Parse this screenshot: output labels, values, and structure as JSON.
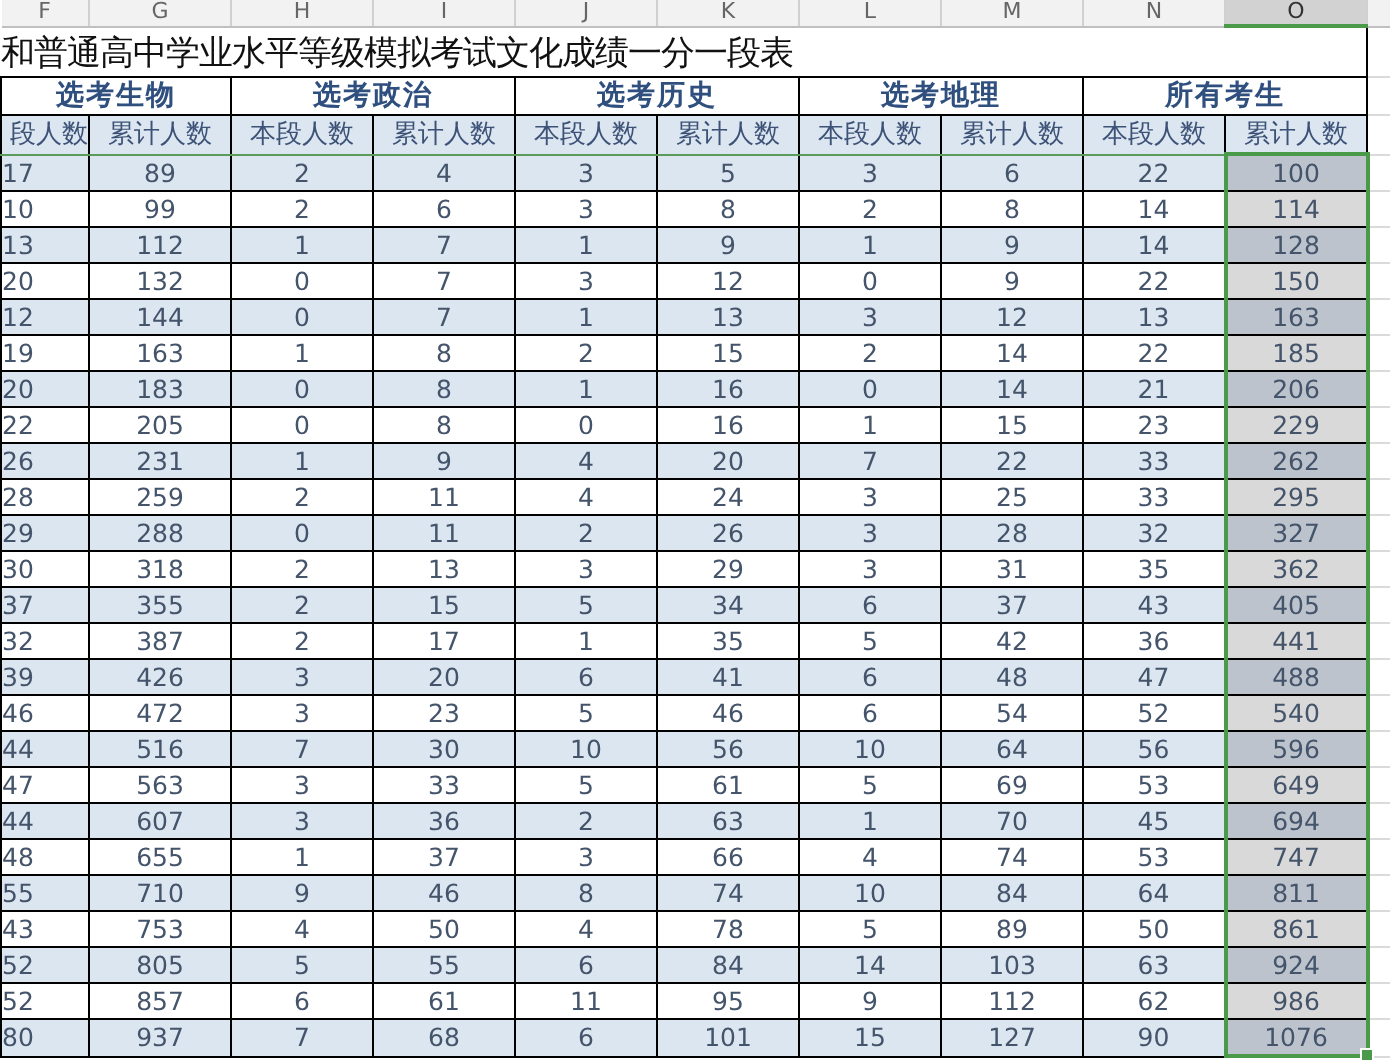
{
  "columns": [
    {
      "letter": "F",
      "selected": false
    },
    {
      "letter": "G",
      "selected": false
    },
    {
      "letter": "H",
      "selected": false
    },
    {
      "letter": "I",
      "selected": false
    },
    {
      "letter": "J",
      "selected": false
    },
    {
      "letter": "K",
      "selected": false
    },
    {
      "letter": "L",
      "selected": false
    },
    {
      "letter": "M",
      "selected": false
    },
    {
      "letter": "N",
      "selected": false
    },
    {
      "letter": "O",
      "selected": true
    }
  ],
  "title": "和普通高中学业水平等级模拟考试文化成绩一分一段表",
  "groups": [
    "选考生物",
    "选考政治",
    "选考历史",
    "选考地理",
    "所有考生"
  ],
  "subheaders": [
    "段人数",
    "累计人数",
    "本段人数",
    "累计人数",
    "本段人数",
    "累计人数",
    "本段人数",
    "累计人数",
    "本段人数",
    "累计人数"
  ],
  "rows": [
    {
      "cells": [
        "17",
        "89",
        "2",
        "4",
        "3",
        "5",
        "3",
        "6",
        "22",
        "100"
      ]
    },
    {
      "cells": [
        "10",
        "99",
        "2",
        "6",
        "3",
        "8",
        "2",
        "8",
        "14",
        "114"
      ]
    },
    {
      "cells": [
        "13",
        "112",
        "1",
        "7",
        "1",
        "9",
        "1",
        "9",
        "14",
        "128"
      ]
    },
    {
      "cells": [
        "20",
        "132",
        "0",
        "7",
        "3",
        "12",
        "0",
        "9",
        "22",
        "150"
      ]
    },
    {
      "cells": [
        "12",
        "144",
        "0",
        "7",
        "1",
        "13",
        "3",
        "12",
        "13",
        "163"
      ]
    },
    {
      "cells": [
        "19",
        "163",
        "1",
        "8",
        "2",
        "15",
        "2",
        "14",
        "22",
        "185"
      ]
    },
    {
      "cells": [
        "20",
        "183",
        "0",
        "8",
        "1",
        "16",
        "0",
        "14",
        "21",
        "206"
      ]
    },
    {
      "cells": [
        "22",
        "205",
        "0",
        "8",
        "0",
        "16",
        "1",
        "15",
        "23",
        "229"
      ]
    },
    {
      "cells": [
        "26",
        "231",
        "1",
        "9",
        "4",
        "20",
        "7",
        "22",
        "33",
        "262"
      ]
    },
    {
      "cells": [
        "28",
        "259",
        "2",
        "11",
        "4",
        "24",
        "3",
        "25",
        "33",
        "295"
      ]
    },
    {
      "cells": [
        "29",
        "288",
        "0",
        "11",
        "2",
        "26",
        "3",
        "28",
        "32",
        "327"
      ]
    },
    {
      "cells": [
        "30",
        "318",
        "2",
        "13",
        "3",
        "29",
        "3",
        "31",
        "35",
        "362"
      ]
    },
    {
      "cells": [
        "37",
        "355",
        "2",
        "15",
        "5",
        "34",
        "6",
        "37",
        "43",
        "405"
      ]
    },
    {
      "cells": [
        "32",
        "387",
        "2",
        "17",
        "1",
        "35",
        "5",
        "42",
        "36",
        "441"
      ]
    },
    {
      "cells": [
        "39",
        "426",
        "3",
        "20",
        "6",
        "41",
        "6",
        "48",
        "47",
        "488"
      ]
    },
    {
      "cells": [
        "46",
        "472",
        "3",
        "23",
        "5",
        "46",
        "6",
        "54",
        "52",
        "540"
      ]
    },
    {
      "cells": [
        "44",
        "516",
        "7",
        "30",
        "10",
        "56",
        "10",
        "64",
        "56",
        "596"
      ]
    },
    {
      "cells": [
        "47",
        "563",
        "3",
        "33",
        "5",
        "61",
        "5",
        "69",
        "53",
        "649"
      ]
    },
    {
      "cells": [
        "44",
        "607",
        "3",
        "36",
        "2",
        "63",
        "1",
        "70",
        "45",
        "694"
      ]
    },
    {
      "cells": [
        "48",
        "655",
        "1",
        "37",
        "3",
        "66",
        "4",
        "74",
        "53",
        "747"
      ]
    },
    {
      "cells": [
        "55",
        "710",
        "9",
        "46",
        "8",
        "74",
        "10",
        "84",
        "64",
        "811"
      ]
    },
    {
      "cells": [
        "43",
        "753",
        "4",
        "50",
        "4",
        "78",
        "5",
        "89",
        "50",
        "861"
      ]
    },
    {
      "cells": [
        "52",
        "805",
        "5",
        "55",
        "6",
        "84",
        "14",
        "103",
        "63",
        "924"
      ]
    },
    {
      "cells": [
        "52",
        "857",
        "6",
        "61",
        "11",
        "95",
        "9",
        "112",
        "62",
        "986"
      ]
    },
    {
      "cells": [
        "80",
        "937",
        "7",
        "68",
        "6",
        "101",
        "15",
        "127",
        "90",
        "1076"
      ]
    }
  ]
}
